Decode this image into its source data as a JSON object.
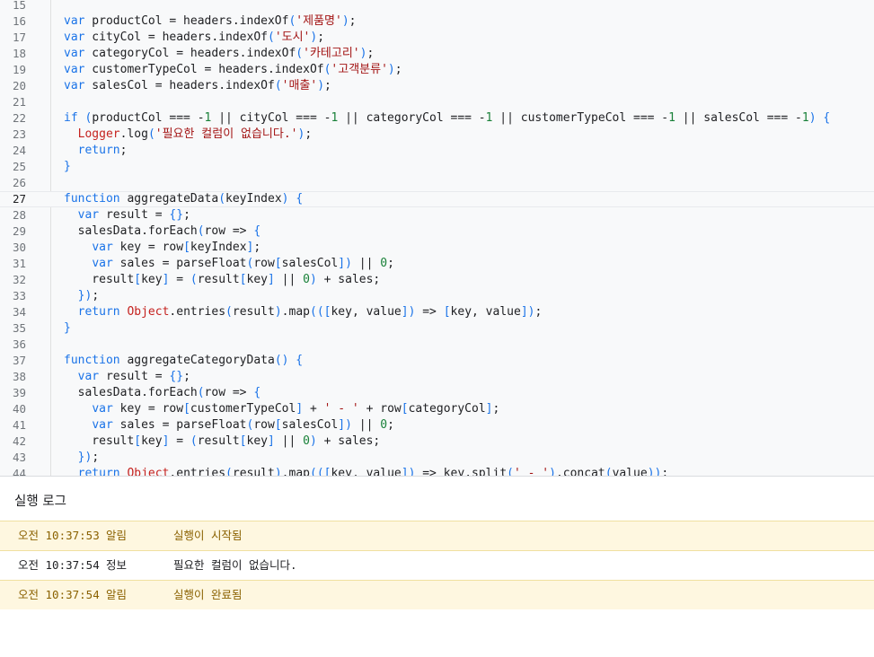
{
  "editor": {
    "lines": [
      {
        "num": "15",
        "code": ""
      },
      {
        "num": "16",
        "code": ""
      },
      {
        "num": "17",
        "code": ""
      },
      {
        "num": "18",
        "code": ""
      },
      {
        "num": "19",
        "code": ""
      },
      {
        "num": "20",
        "code": ""
      },
      {
        "num": "21",
        "code": ""
      },
      {
        "num": "22",
        "code": ""
      },
      {
        "num": "23",
        "code": ""
      },
      {
        "num": "24",
        "code": ""
      },
      {
        "num": "25",
        "code": ""
      },
      {
        "num": "26",
        "code": ""
      },
      {
        "num": "27",
        "code": ""
      },
      {
        "num": "28",
        "code": ""
      },
      {
        "num": "29",
        "code": ""
      },
      {
        "num": "30",
        "code": ""
      },
      {
        "num": "31",
        "code": ""
      },
      {
        "num": "32",
        "code": ""
      },
      {
        "num": "33",
        "code": ""
      },
      {
        "num": "34",
        "code": ""
      },
      {
        "num": "35",
        "code": ""
      },
      {
        "num": "36",
        "code": ""
      },
      {
        "num": "37",
        "code": ""
      },
      {
        "num": "38",
        "code": ""
      },
      {
        "num": "39",
        "code": ""
      },
      {
        "num": "40",
        "code": ""
      },
      {
        "num": "41",
        "code": ""
      },
      {
        "num": "42",
        "code": ""
      },
      {
        "num": "43",
        "code": ""
      },
      {
        "num": "44",
        "code": ""
      }
    ],
    "current_line": "27",
    "code_text": [
      "",
      "var productCol = headers.indexOf('제품명');",
      "var cityCol = headers.indexOf('도시');",
      "var categoryCol = headers.indexOf('카테고리');",
      "var customerTypeCol = headers.indexOf('고객분류');",
      "var salesCol = headers.indexOf('매출');",
      "",
      "if (productCol === -1 || cityCol === -1 || categoryCol === -1 || customerTypeCol === -1 || salesCol === -1) {",
      "  Logger.log('필요한 컬럼이 없습니다.');",
      "  return;",
      "}",
      "",
      "function aggregateData(keyIndex) {",
      "  var result = {};",
      "  salesData.forEach(row => {",
      "    var key = row[keyIndex];",
      "    var sales = parseFloat(row[salesCol]) || 0;",
      "    result[key] = (result[key] || 0) + sales;",
      "  });",
      "  return Object.entries(result).map(([key, value]) => [key, value]);",
      "}",
      "",
      "function aggregateCategoryData() {",
      "  var result = {};",
      "  salesData.forEach(row => {",
      "    var key = row[customerTypeCol] + ' - ' + row[categoryCol];",
      "    var sales = parseFloat(row[salesCol]) || 0;",
      "    result[key] = (result[key] || 0) + sales;",
      "  });",
      "  return Object.entries(result).map(([key, value]) => key.split(' - ').concat(value));"
    ]
  },
  "log": {
    "title": "실행 로그",
    "entries": [
      {
        "time": "오전 10:37:53",
        "level": "알림",
        "message": "실행이 시작됨",
        "type": "notice"
      },
      {
        "time": "오전 10:37:54",
        "level": "정보",
        "message": "필요한 컬럼이 없습니다.",
        "type": "info"
      },
      {
        "time": "오전 10:37:54",
        "level": "알림",
        "message": "실행이 완료됨",
        "type": "notice"
      }
    ]
  }
}
